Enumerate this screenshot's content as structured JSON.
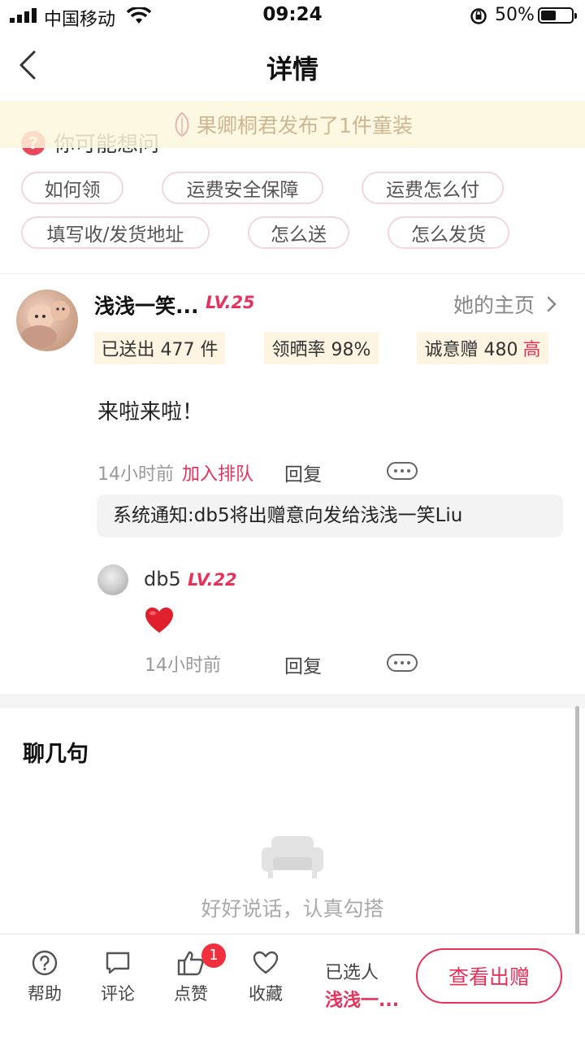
{
  "status_bar": {
    "carrier": "中国移动",
    "time": "09:24",
    "battery": "50%"
  },
  "nav": {
    "title": "详情"
  },
  "notice": {
    "text": "果卿桐君发布了1件童装"
  },
  "faq": {
    "heading": "你可能想问",
    "tags": [
      "如何领",
      "运费安全保障",
      "运费怎么付",
      "填写收/发货地址",
      "怎么送",
      "怎么发货"
    ]
  },
  "post": {
    "username": "浅浅一笑...",
    "level": "LV.25",
    "homepage_link": "她的主页",
    "stats": [
      {
        "label": "已送出 477 件"
      },
      {
        "label": "领晒率 98%"
      },
      {
        "label": "诚意赠 480",
        "highlight": "高"
      }
    ],
    "content": "来啦来啦！",
    "time_ago": "14小时前",
    "join_queue": "加入排队",
    "reply": "回复",
    "system_note": "系统通知:db5将出赠意向发给浅浅一笑Liu"
  },
  "comment": {
    "username": "db5",
    "level": "LV.22",
    "time_ago": "14小时前",
    "reply": "回复"
  },
  "chat": {
    "title": "聊几句",
    "empty_text": "好好说话，认真勾搭"
  },
  "bottom_bar": {
    "help": "帮助",
    "comment": "评论",
    "like": "点赞",
    "like_count": "1",
    "favorite": "收藏",
    "chosen_label": "已选人",
    "chosen_name": "浅浅一...",
    "view_gift": "查看出赠"
  },
  "colors": {
    "accent": "#e6325a",
    "stat_bg": "#fdf4e1",
    "badge": "#f0303e"
  }
}
